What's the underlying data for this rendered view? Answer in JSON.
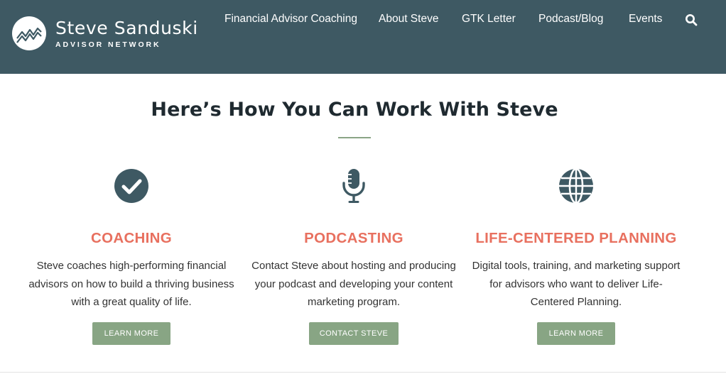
{
  "logo": {
    "name": "Steve Sanduski",
    "subtitle": "ADVISOR NETWORK"
  },
  "nav": {
    "items": [
      {
        "label": "Financial Advisor Coaching"
      },
      {
        "label": "About Steve"
      },
      {
        "label": "GTK Letter"
      },
      {
        "label": "Podcast/Blog"
      },
      {
        "label": "Events"
      }
    ],
    "search_icon": "search-icon"
  },
  "main": {
    "title": "Here’s How You Can Work With Steve",
    "columns": [
      {
        "icon": "check-circle-icon",
        "heading": "COACHING",
        "text": "Steve coaches high-performing financial advisors on how to build a thriving business with a great quality of life.",
        "button": "LEARN MORE"
      },
      {
        "icon": "microphone-icon",
        "heading": "PODCASTING",
        "text": "Contact Steve about hosting and producing your podcast and developing your content marketing program.",
        "button": "CONTACT STEVE"
      },
      {
        "icon": "globe-icon",
        "heading": "LIFE-CENTERED PLANNING",
        "text": "Digital tools, training, and marketing support for advisors who want to deliver Life-Centered Planning.",
        "button": "LEARN MORE"
      }
    ]
  },
  "colors": {
    "nav_background": "#3e5963",
    "heading_accent": "#e8705f",
    "button_background": "#88a584",
    "icon_color": "#3e5963",
    "title_color": "#1f2a30"
  }
}
